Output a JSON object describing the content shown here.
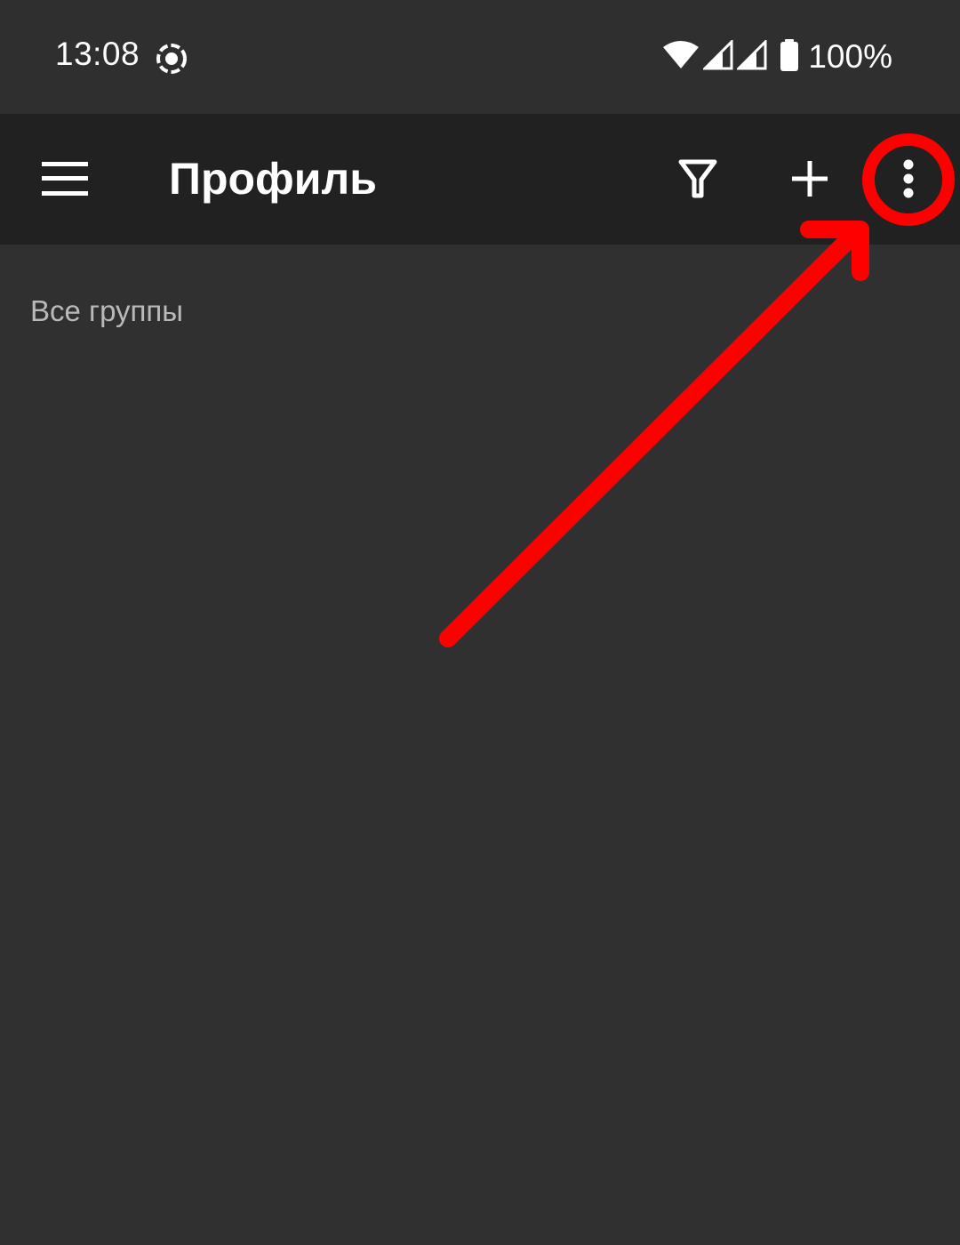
{
  "status_bar": {
    "time": "13:08",
    "battery_percent": "100%",
    "icons": [
      "screen-record-icon",
      "wifi-icon",
      "signal-icon",
      "signal-icon",
      "battery-icon"
    ]
  },
  "app_bar": {
    "title": "Профиль",
    "actions": [
      "menu-icon",
      "filter-icon",
      "add-icon",
      "more-vert-icon"
    ]
  },
  "content": {
    "groups_label": "Все группы"
  },
  "colors": {
    "status_bar_bg": "#2f2f2f",
    "app_bar_bg": "#212121",
    "content_bg": "#303030",
    "label_text": "#b9b9b9",
    "annotation": "#ff0000"
  }
}
